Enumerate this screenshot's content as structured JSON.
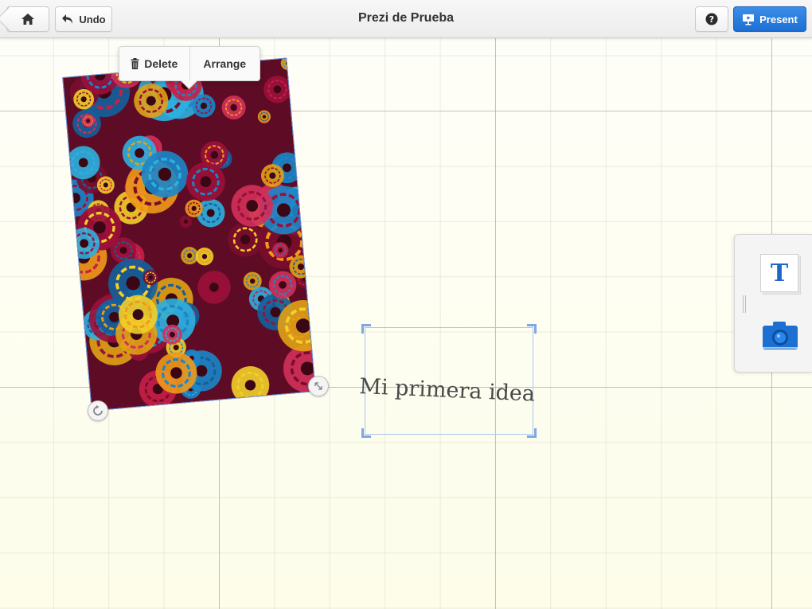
{
  "toolbar": {
    "title": "Prezi de Prueba",
    "undo_label": "Undo",
    "present_label": "Present",
    "help_label": "?"
  },
  "context_menu": {
    "delete_label": "Delete",
    "arrange_label": "Arrange"
  },
  "canvas": {
    "text_frame_content": "Mi primera idea"
  },
  "side_panel": {
    "text_tool_glyph": "T"
  },
  "icons": {
    "home": "home-icon",
    "undo": "undo-arrow-icon",
    "help": "question-icon",
    "present": "present-screen-icon",
    "delete": "trash-icon",
    "rotate": "rotate-icon",
    "resize": "resize-diagonal-icon",
    "text_tool": "text-icon",
    "image_tool": "camera-icon"
  },
  "colors": {
    "accent_blue": "#1c6ed3",
    "selection_blue": "#6fa0e8",
    "canvas_bg": "#fdfdea"
  }
}
